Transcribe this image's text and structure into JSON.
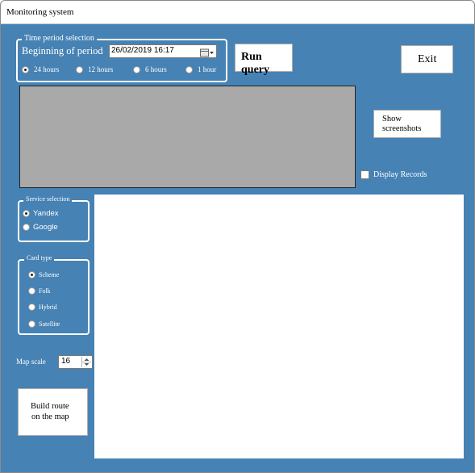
{
  "window": {
    "title": "Monitoring system"
  },
  "time_period": {
    "legend": "Time period selection",
    "beginning_label": "Beginning of period",
    "datetime_value": "26/02/2019 16:17",
    "options": [
      "24 hours",
      "12 hours",
      "6 hours",
      "1 hour"
    ],
    "selected": "24 hours"
  },
  "buttons": {
    "run_query": "Run query",
    "exit": "Exit",
    "show_screenshots_line1": "Show",
    "show_screenshots_line2": "screenshots",
    "build_route_line1": "Build route",
    "build_route_line2": "on the map"
  },
  "display_records": {
    "label": "Display Records",
    "checked": false
  },
  "service": {
    "legend": "Service selection",
    "options": [
      "Yandex",
      "Google"
    ],
    "selected": "Yandex"
  },
  "card_type": {
    "legend": "Card type",
    "options": [
      "Scheme",
      "Folk",
      "Hybrid",
      "Satellite"
    ],
    "selected": "Scheme"
  },
  "map_scale": {
    "label": "Map scale",
    "value": "16"
  },
  "colors": {
    "background": "#4682b4",
    "panel_gray": "#a9a9a9"
  },
  "icons": {
    "calendar": "calendar-icon",
    "spinner": "spinner-icon"
  }
}
